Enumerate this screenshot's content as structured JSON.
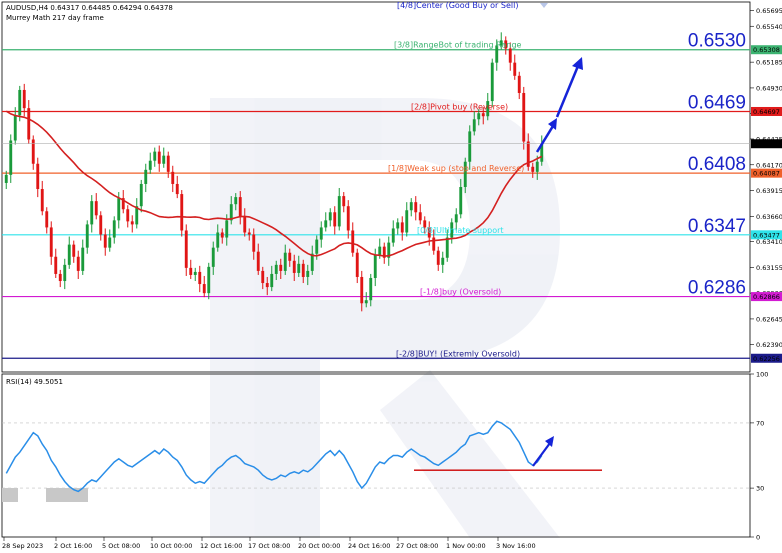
{
  "header": {
    "symbol_line": "AUDUSD,H4  0.64317 0.64485 0.64294 0.64378",
    "indicator_line": "Murrey Math 217 day frame",
    "top_level_label": "[4/8]Center (Good Buy or Sell)"
  },
  "chart_data": {
    "type": "candlestick",
    "symbol": "AUDUSD",
    "timeframe": "H4",
    "ohlc_last": {
      "open": 0.64317,
      "high": 0.64485,
      "low": 0.64294,
      "close": 0.64378
    },
    "price_axis_ticks": [
      "0.65695",
      "0.65540",
      "0.65185",
      "0.64930",
      "0.64675",
      "0.64425",
      "0.64170",
      "0.63915",
      "0.63660",
      "0.63410",
      "0.63155",
      "0.62900",
      "0.62645",
      "0.62390"
    ],
    "x_tick_labels": [
      "28 Sep 2023",
      "2 Oct 16:00",
      "5 Oct 08:00",
      "10 Oct 00:00",
      "12 Oct 16:00",
      "17 Oct 08:00",
      "20 Oct 00:00",
      "24 Oct 16:00",
      "27 Oct 08:00",
      "1 Nov 00:00",
      "3 Nov 16:00"
    ],
    "ylim": [
      0.6212,
      0.6578
    ],
    "current_price": 0.64378,
    "murrey_levels": [
      {
        "label": "[3/8]RangeBot of trading Range",
        "value": 0.65308,
        "axis_tag": "0.65308",
        "big_tag": "0.6530",
        "color": "#3cb371"
      },
      {
        "label": "[2/8]Pivot buy (Reverse)",
        "value": 0.64697,
        "axis_tag": "0.64697",
        "big_tag": "0.6469",
        "color": "#e11b1b"
      },
      {
        "label": "[1/8]Weak sup (stop and Reverse)",
        "value": 0.64087,
        "axis_tag": "0.64087",
        "big_tag": "0.6408",
        "color": "#f0602a"
      },
      {
        "label": "[0/8]Ultimate support",
        "value": 0.63477,
        "axis_tag": "0.63477",
        "big_tag": "0.6347",
        "color": "#2ee3ea"
      },
      {
        "label": "[-1/8]buy (Oversold)",
        "value": 0.62866,
        "axis_tag": "0.62866",
        "big_tag": "0.6286",
        "color": "#d21ad2"
      },
      {
        "label": "[-2/8]BUY! (Extremly Oversold)",
        "value": 0.62256,
        "axis_tag": "0.62256",
        "big_tag": "",
        "color": "#1b1b8a"
      }
    ],
    "closes": [
      0.6407,
      0.6441,
      0.6466,
      0.6491,
      0.6473,
      0.6442,
      0.6418,
      0.6393,
      0.6371,
      0.6355,
      0.6326,
      0.6309,
      0.6302,
      0.6318,
      0.6338,
      0.6326,
      0.6312,
      0.6335,
      0.6358,
      0.6381,
      0.6367,
      0.6348,
      0.6335,
      0.6345,
      0.6362,
      0.6384,
      0.6373,
      0.6361,
      0.6358,
      0.6376,
      0.6398,
      0.6412,
      0.6421,
      0.643,
      0.6418,
      0.6426,
      0.641,
      0.6398,
      0.6388,
      0.6352,
      0.6315,
      0.6308,
      0.6311,
      0.6299,
      0.629,
      0.6316,
      0.6335,
      0.635,
      0.6345,
      0.6362,
      0.6378,
      0.6385,
      0.6366,
      0.635,
      0.6348,
      0.6331,
      0.6312,
      0.63,
      0.6296,
      0.6309,
      0.6318,
      0.6312,
      0.633,
      0.6322,
      0.631,
      0.6319,
      0.6306,
      0.6312,
      0.6329,
      0.6343,
      0.6355,
      0.6362,
      0.637,
      0.6356,
      0.6386,
      0.6376,
      0.6352,
      0.633,
      0.6306,
      0.628,
      0.6283,
      0.6305,
      0.6328,
      0.6336,
      0.6325,
      0.634,
      0.6354,
      0.636,
      0.635,
      0.6372,
      0.638,
      0.637,
      0.6362,
      0.6355,
      0.6345,
      0.6332,
      0.6318,
      0.6325,
      0.6345,
      0.636,
      0.6368,
      0.6395,
      0.642,
      0.645,
      0.6462,
      0.6468,
      0.6465,
      0.648,
      0.6518,
      0.6535,
      0.654,
      0.6532,
      0.6518,
      0.6505,
      0.6488,
      0.644,
      0.6415,
      0.641,
      0.642,
      0.6438
    ],
    "ma_label": "",
    "rsi": {
      "title": "RSI(14) 49.5051",
      "period": 14,
      "value": 49.5051,
      "ylim": [
        0,
        100
      ],
      "ticks": [
        100,
        70,
        30,
        0
      ],
      "support_level": 41,
      "values": [
        39,
        44,
        49,
        52,
        56,
        60,
        64,
        62,
        57,
        53,
        47,
        43,
        38,
        34,
        31,
        29,
        28,
        30,
        33,
        35,
        34,
        37,
        40,
        43,
        46,
        48,
        46,
        44,
        43,
        45,
        47,
        49,
        51,
        53,
        51,
        54,
        52,
        49,
        47,
        43,
        38,
        35,
        33,
        34,
        33,
        36,
        39,
        42,
        44,
        47,
        49,
        50,
        48,
        45,
        44,
        43,
        41,
        38,
        36,
        35,
        36,
        38,
        37,
        39,
        40,
        39,
        41,
        40,
        42,
        45,
        48,
        51,
        53,
        50,
        53,
        50,
        45,
        40,
        34,
        30,
        33,
        38,
        43,
        46,
        45,
        48,
        50,
        50,
        49,
        52,
        54,
        52,
        50,
        49,
        47,
        45,
        44,
        46,
        48,
        50,
        52,
        55,
        57,
        62,
        63,
        64,
        63,
        64,
        68,
        71,
        70,
        68,
        66,
        62,
        58,
        52,
        46,
        44,
        46,
        50
      ]
    },
    "forecast_arrows": "up"
  }
}
